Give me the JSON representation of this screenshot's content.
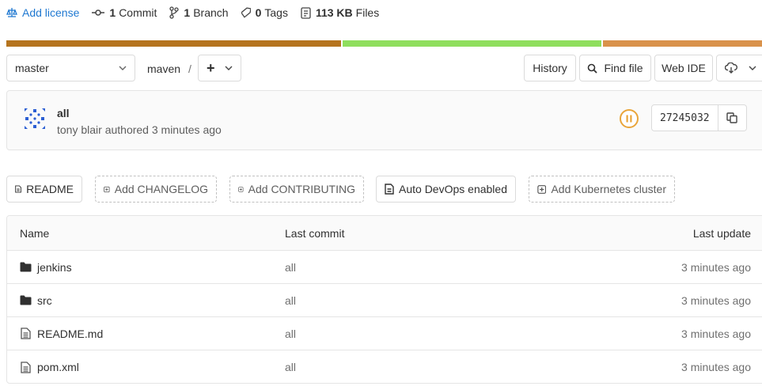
{
  "stats": {
    "add_license": "Add license",
    "commits_count": "1",
    "commits_label": "Commit",
    "branches_count": "1",
    "branches_label": "Branch",
    "tags_count": "0",
    "tags_label": "Tags",
    "files_size": "113 KB",
    "files_label": "Files"
  },
  "language_bar": [
    {
      "color": "#b5741e",
      "fraction": 0.445
    },
    {
      "color": "#8fde5d",
      "fraction": 0.345
    },
    {
      "color": "#d9924b",
      "fraction": 0.21
    }
  ],
  "toolbar": {
    "branch": "master",
    "breadcrumb": "maven",
    "separator": "/",
    "add_label": "+",
    "history_label": "History",
    "find_file_label": "Find file",
    "web_ide_label": "Web IDE"
  },
  "commit": {
    "title": "all",
    "meta": "tony blair authored 3 minutes ago",
    "sha": "27245032",
    "pipeline_status": "paused",
    "pipeline_color": "#e9a53a"
  },
  "quick_links": [
    {
      "label": "README",
      "icon": "doc-icon",
      "style": "solid"
    },
    {
      "label": "Add CHANGELOG",
      "icon": "plus-square-icon",
      "style": "dashed"
    },
    {
      "label": "Add CONTRIBUTING",
      "icon": "plus-square-icon",
      "style": "dashed"
    },
    {
      "label": "Auto DevOps enabled",
      "icon": "doc-icon",
      "style": "solid"
    },
    {
      "label": "Add Kubernetes cluster",
      "icon": "plus-square-icon",
      "style": "dashed"
    }
  ],
  "table": {
    "headers": {
      "name": "Name",
      "last_commit": "Last commit",
      "last_update": "Last update"
    },
    "rows": [
      {
        "name": "jenkins",
        "type": "folder",
        "commit": "all",
        "updated": "3 minutes ago"
      },
      {
        "name": "src",
        "type": "folder",
        "commit": "all",
        "updated": "3 minutes ago"
      },
      {
        "name": "README.md",
        "type": "file",
        "commit": "all",
        "updated": "3 minutes ago"
      },
      {
        "name": "pom.xml",
        "type": "file",
        "commit": "all",
        "updated": "3 minutes ago"
      }
    ]
  }
}
